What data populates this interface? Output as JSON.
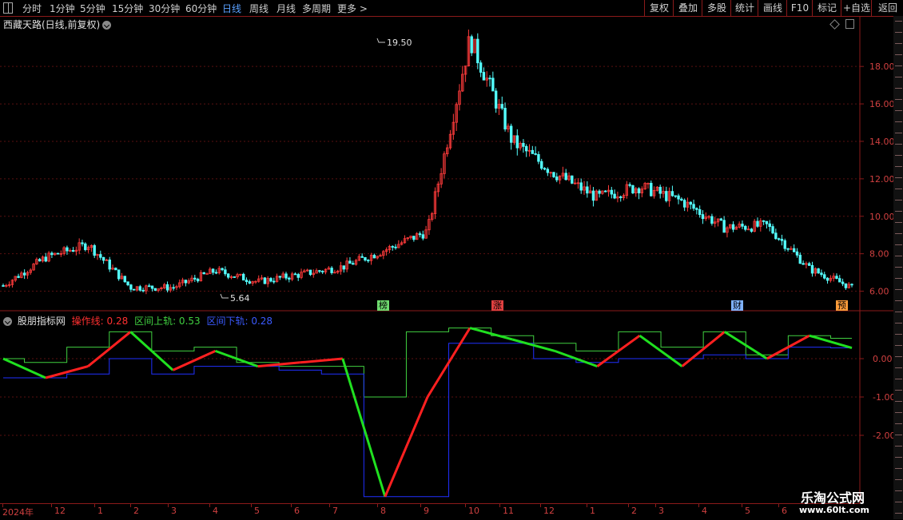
{
  "toolbar": {
    "periods": [
      "分时",
      "1分钟",
      "5分钟",
      "15分钟",
      "30分钟",
      "60分钟",
      "日线",
      "周线",
      "月线",
      "多周期",
      "更多 >"
    ],
    "active_period": "日线",
    "right_buttons": [
      "复权",
      "叠加",
      "多股",
      "统计",
      "画线",
      "F10",
      "标记",
      "+自选",
      "返回"
    ]
  },
  "main_chart": {
    "title": "西藏天路(日线,前复权)",
    "high_label": "19.50",
    "low_label": "5.64",
    "price_axis": [
      "18.00",
      "16.00",
      "14.00",
      "12.00",
      "10.00",
      "8.00",
      "6.00"
    ],
    "events": [
      {
        "label": "榜",
        "color": "#6fdc6f"
      },
      {
        "label": "涨",
        "color": "#e04040"
      },
      {
        "label": "财",
        "color": "#7fb2ff"
      },
      {
        "label": "预",
        "color": "#ff9d3a"
      }
    ]
  },
  "indicator": {
    "name": "股朋指标网",
    "op_label": "操作线: 0.28",
    "upper_label": "区间上轨: 0.53",
    "lower_label": "区间下轨: 0.28",
    "axis": [
      "0.00",
      "-1.00",
      "-2.00"
    ],
    "colors": {
      "op_up": "#ff2020",
      "op_down": "#20e020",
      "upper": "#40d040",
      "lower": "#2030ff"
    }
  },
  "date_axis": [
    "2024年",
    "12",
    "1",
    "2",
    "3",
    "4",
    "5",
    "6",
    "7",
    "8",
    "9",
    "10",
    "11",
    "12",
    "1",
    "2",
    "3",
    "4",
    "5",
    "6"
  ],
  "watermark": {
    "cn": "乐淘公式网",
    "url": "www.60lt.com"
  },
  "chart_data": {
    "type": "line",
    "title": "西藏天路(日线,前复权)",
    "ylabel": "",
    "ylim": [
      5.0,
      20.0
    ],
    "x": [
      "2024年",
      "12",
      "1",
      "2",
      "3",
      "4",
      "5",
      "6",
      "7",
      "8",
      "9",
      "10",
      "11",
      "12",
      "1",
      "2",
      "3",
      "4",
      "5",
      "6"
    ],
    "series": [
      {
        "values": [
          6.3,
          7.8,
          8.5,
          6.2,
          6.2,
          7.1,
          6.5,
          6.9,
          7.3,
          8.2,
          9.2,
          19.5,
          14.0,
          12.3,
          11.0,
          11.6,
          10.8,
          9.4,
          9.5,
          7.2,
          6.2
        ]
      }
    ],
    "indicator_series": [
      {
        "name": "操作线",
        "values": [
          0.0,
          -0.5,
          -0.2,
          0.7,
          -0.3,
          0.2,
          -0.2,
          -0.1,
          0.0,
          -3.6,
          -1.0,
          0.8,
          0.5,
          0.2,
          -0.2,
          0.6,
          -0.2,
          0.7,
          0.0,
          0.6,
          0.28
        ]
      },
      {
        "name": "区间上轨",
        "values": [
          0.0,
          -0.1,
          0.3,
          0.7,
          0.2,
          0.3,
          -0.1,
          -0.2,
          -0.2,
          -1.0,
          0.7,
          0.8,
          0.6,
          0.4,
          0.2,
          0.7,
          0.3,
          0.7,
          0.1,
          0.6,
          0.53
        ]
      },
      {
        "name": "区间下轨",
        "values": [
          -0.5,
          -0.5,
          -0.4,
          0.0,
          -0.4,
          -0.2,
          -0.2,
          -0.3,
          -0.4,
          -3.6,
          -3.6,
          0.4,
          0.4,
          0.0,
          -0.1,
          0.0,
          0.0,
          0.1,
          0.0,
          0.3,
          0.28
        ]
      }
    ],
    "axis_ticks": [
      18.0,
      16.0,
      14.0,
      12.0,
      10.0,
      8.0,
      6.0
    ],
    "indicator_ticks": [
      0.0,
      -1.0,
      -2.0
    ]
  }
}
